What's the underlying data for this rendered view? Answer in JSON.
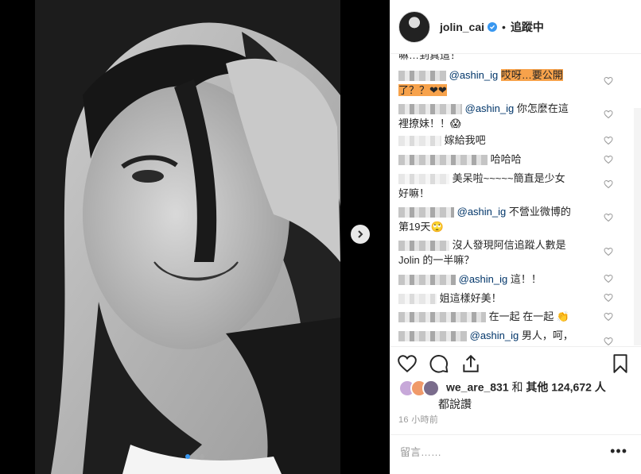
{
  "header": {
    "username": "jolin_cai",
    "separator": "•",
    "follow_status": "追蹤中"
  },
  "comments": [
    {
      "name_blur": true,
      "text_top": "嘛…到真這！",
      "cut": true
    },
    {
      "mention": "@ashin_ig",
      "highlight": "哎呀…要公開",
      "line2": "了？？❤❤"
    },
    {
      "mention": "@ashin_ig",
      "text": "你怎麼在這",
      "line2": "裡撩妹！！😱"
    },
    {
      "text": "嫁給我吧"
    },
    {
      "text": "哈哈哈"
    },
    {
      "text": "美呆啦~~~~~簡直是少女",
      "line2": "好嘛！"
    },
    {
      "mention": "@ashin_ig",
      "text": "不營业微博的",
      "line2": "第19天🙄"
    },
    {
      "text": "沒人發現阿信追蹤人數是",
      "line2": "Jolin 的一半嘛？"
    },
    {
      "mention": "@ashin_ig",
      "text": "這！！"
    },
    {
      "text": "姐這樣好美！"
    },
    {
      "text": "在一起 在一起 👏"
    },
    {
      "mention": "@ashin_ig",
      "text": "男人，呵，"
    }
  ],
  "likes": {
    "first_user": "we_are_831",
    "conj": "和",
    "others_label": "其他 124,672 人",
    "suffix": "都說讚"
  },
  "timestamp": "16 小時前",
  "add_comment": {
    "placeholder": "留言……",
    "more": "•••"
  }
}
